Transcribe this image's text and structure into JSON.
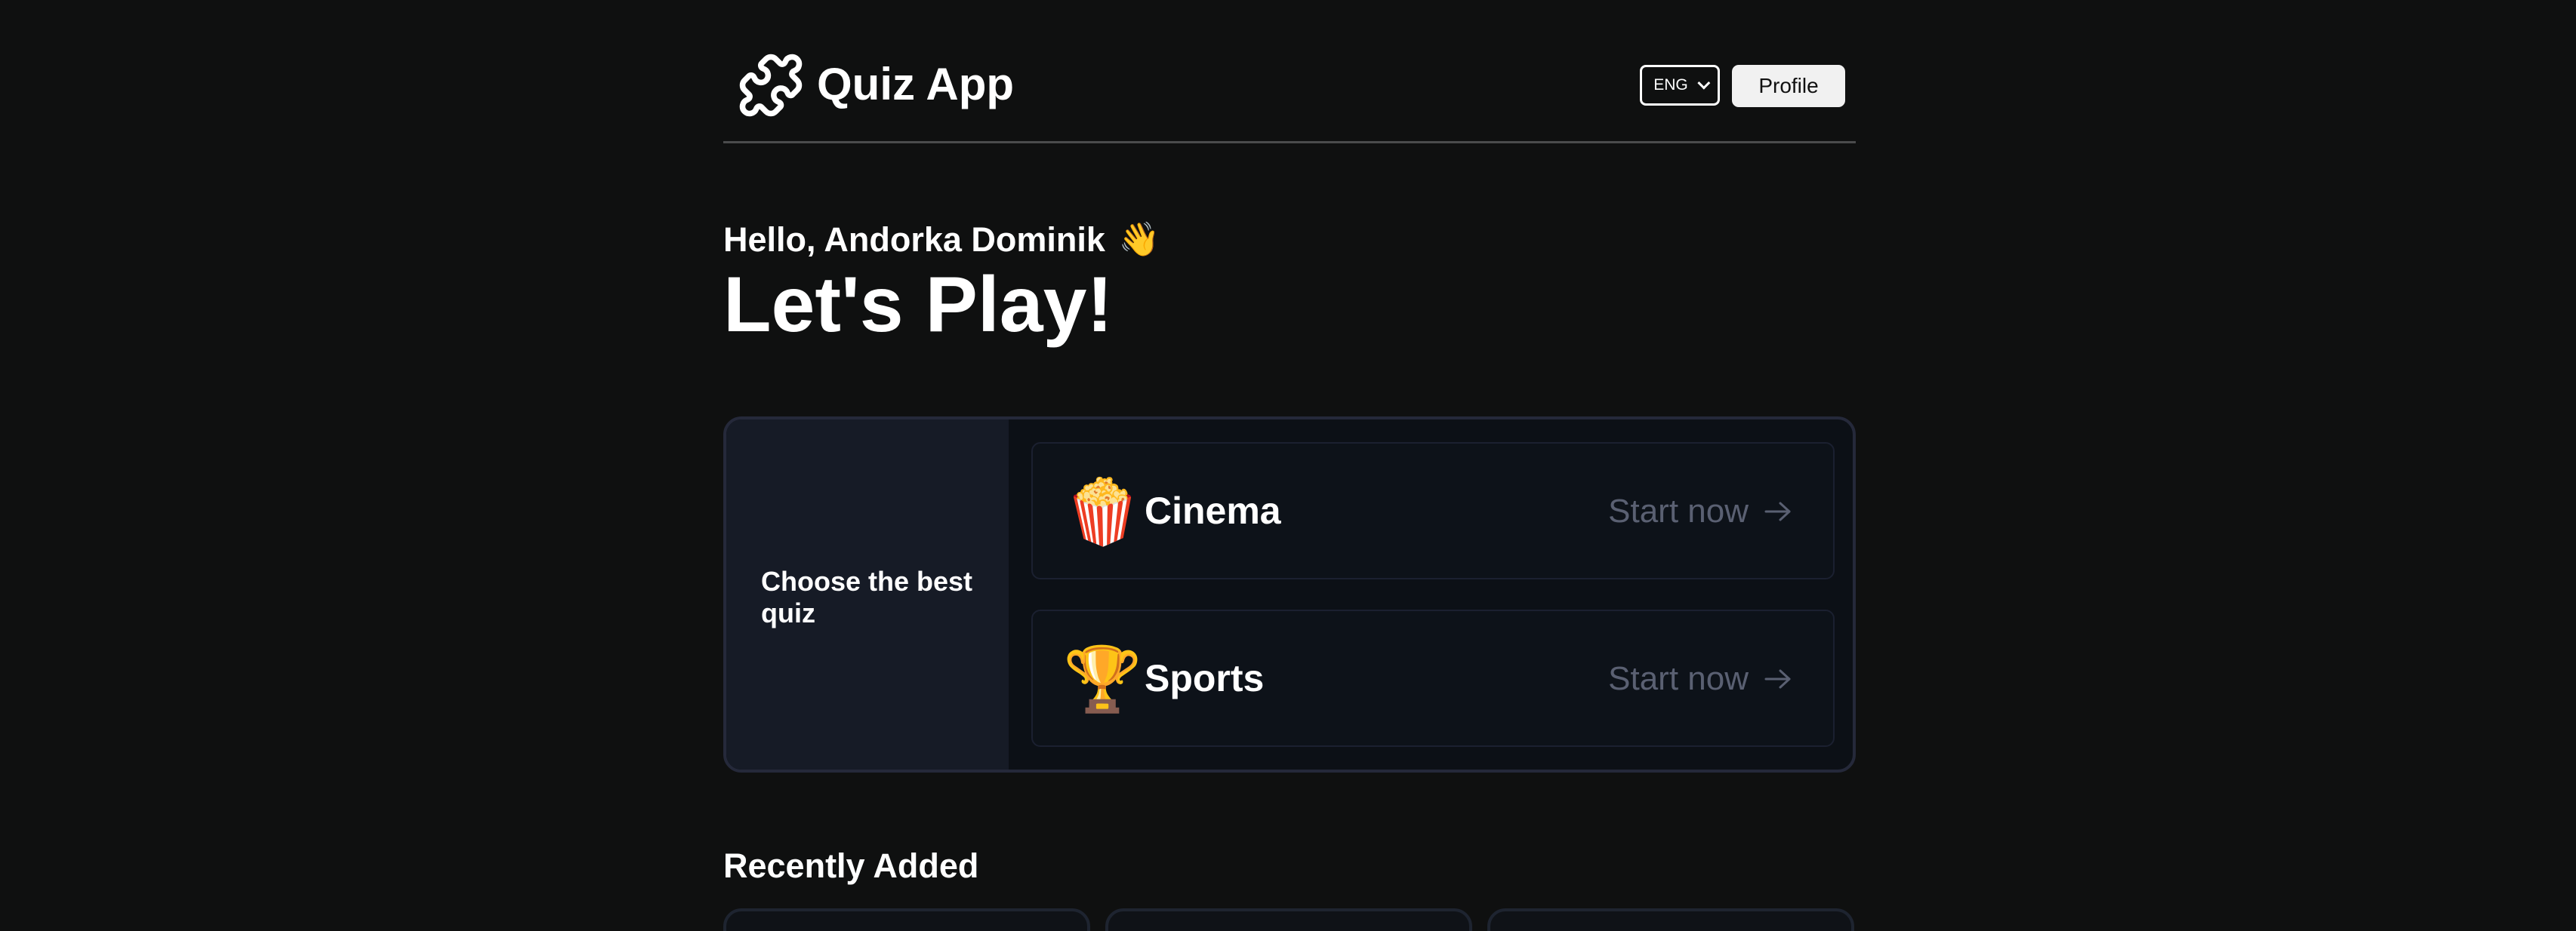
{
  "header": {
    "logo_icon": "puzzle-piece-icon",
    "app_title": "Quiz App",
    "language": {
      "selected": "ENG",
      "icon": "chevron-down-icon"
    },
    "profile_label": "Profile"
  },
  "greeting": {
    "hello": "Hello, Andorka Dominik",
    "hello_emoji": "👋",
    "headline": "Let's Play!"
  },
  "quiz_panel": {
    "prompt": "Choose the best quiz",
    "items": [
      {
        "emoji": "🍿",
        "label": "Cinema",
        "action": "Start now",
        "icon": "arrow-right-icon"
      },
      {
        "emoji": "🏆",
        "label": "Sports",
        "action": "Start now",
        "icon": "arrow-right-icon"
      }
    ]
  },
  "recent": {
    "title": "Recently Added",
    "cards": 3
  },
  "colors": {
    "background": "#0f1010",
    "panel_side": "#161b26",
    "muted_text": "#5a6072",
    "button_bg": "#f1f1f1"
  }
}
